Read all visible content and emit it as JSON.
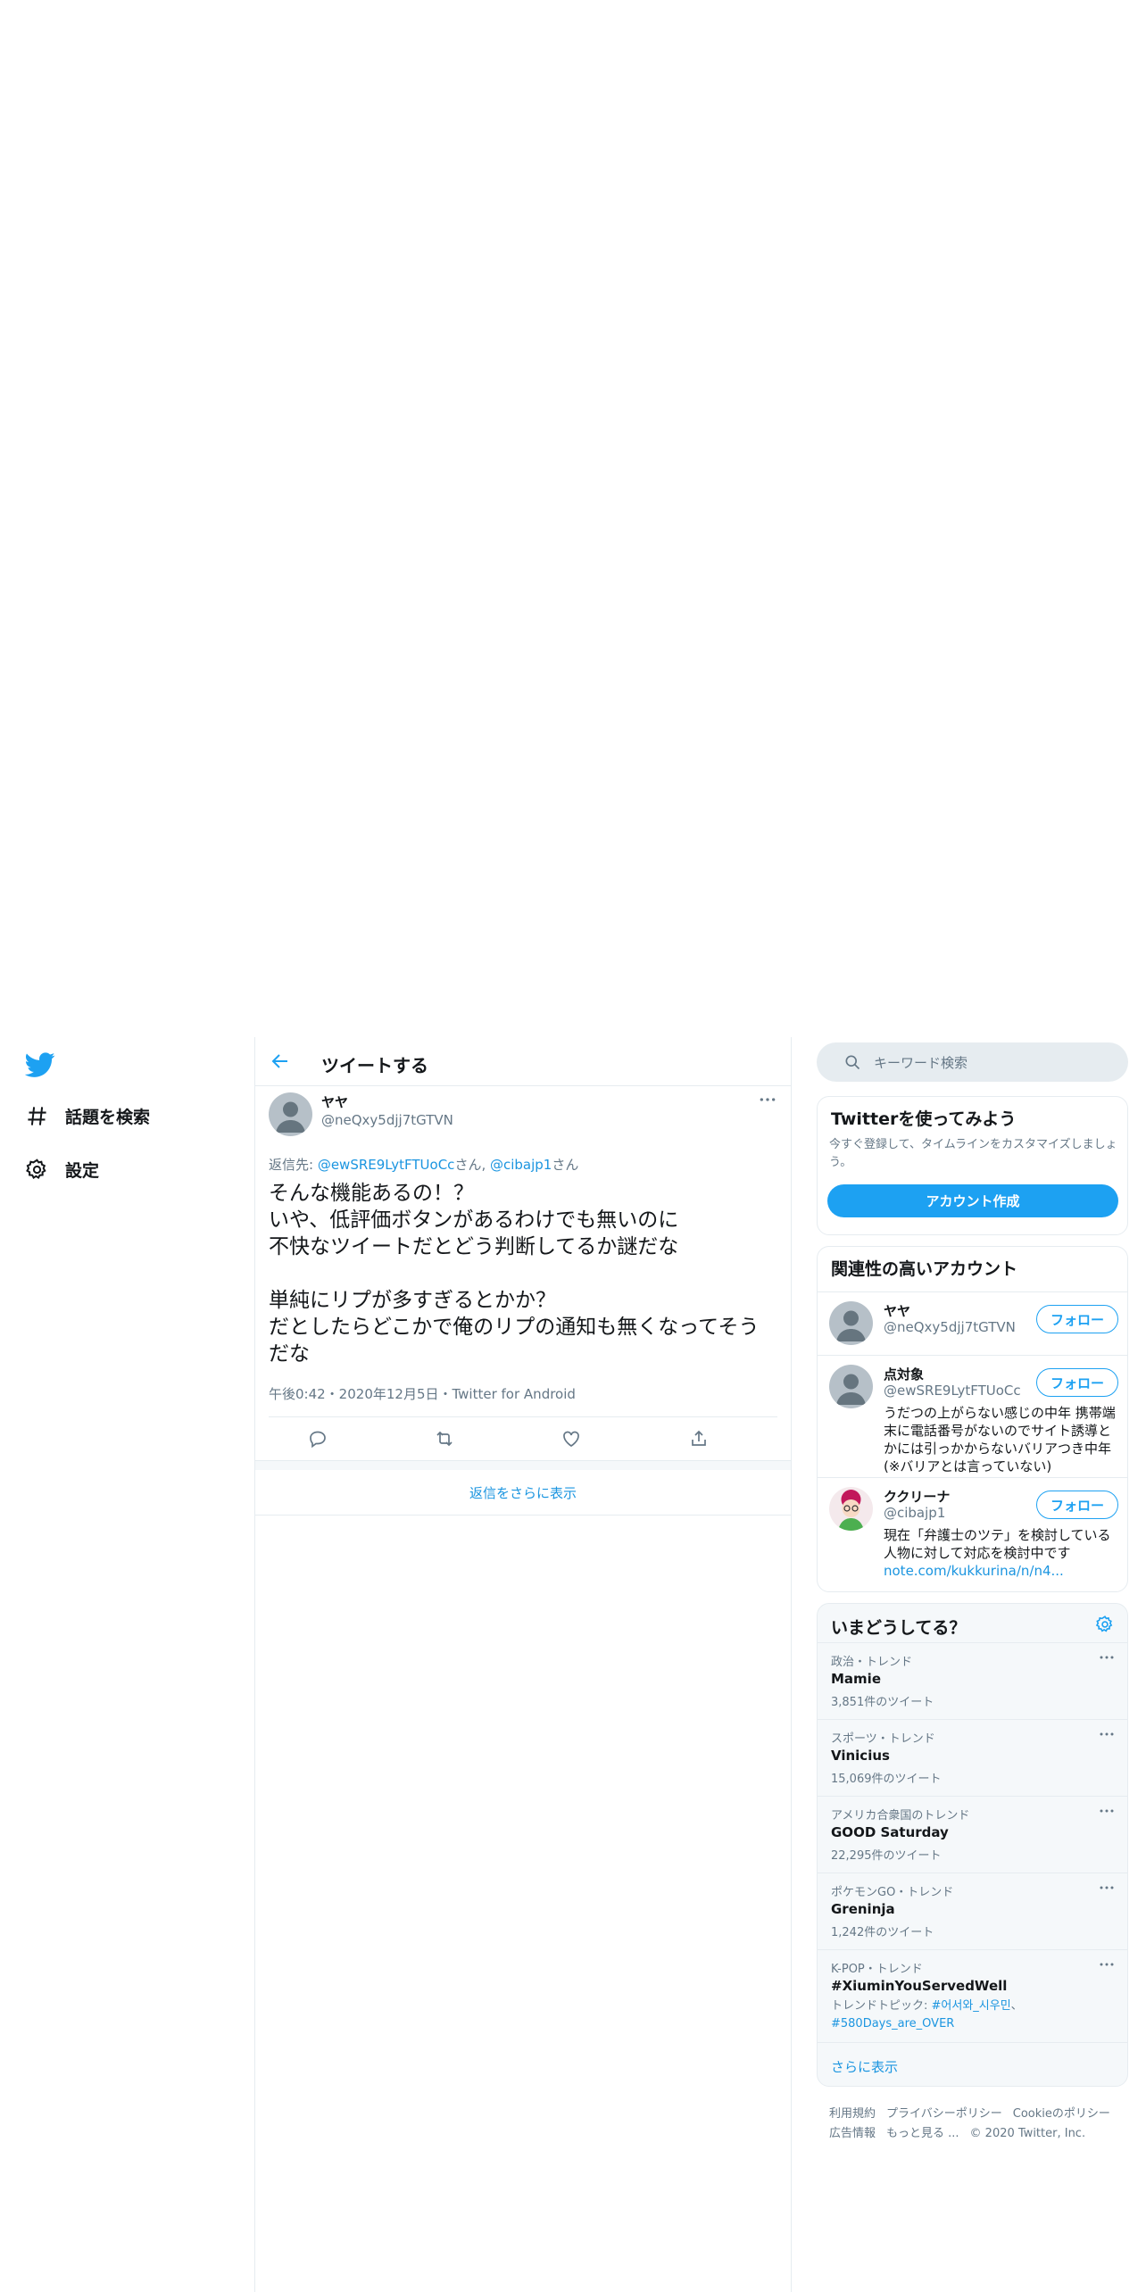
{
  "nav": {
    "items": [
      {
        "label": "話題を検索",
        "icon": "hashtag-icon"
      },
      {
        "label": "設定",
        "icon": "gear-icon"
      }
    ]
  },
  "center": {
    "header_title": "ツイートする",
    "tweet": {
      "name": "ヤヤ",
      "handle": "@neQxy5djj7tGTVN",
      "reply_prefix": "返信先: ",
      "reply_user1": "@ewSRE9LytFTUoCc",
      "reply_sep1": "さん, ",
      "reply_user2": "@cibajp1",
      "reply_sep2": "さん",
      "body": "そんな機能あるの！？\nいや、低評価ボタンがあるわけでも無いのに\n不快なツイートだとどう判断してるか謎だな\n\n単純にリプが多すぎるとかか？\nだとしたらどこかで俺のリプの通知も無くなってそうだな",
      "meta": "午後0:42・2020年12月5日・Twitter for Android"
    },
    "show_more_replies": "返信をさらに表示"
  },
  "right": {
    "search_placeholder": "キーワード検索",
    "signup": {
      "title": "Twitterを使ってみよう",
      "desc": "今すぐ登録して、タイムラインをカスタマイズしましょう。",
      "button": "アカウント作成"
    },
    "related": {
      "title": "関連性の高いアカウント",
      "follow_label": "フォロー",
      "accounts": [
        {
          "name": "ヤヤ",
          "handle": "@neQxy5djj7tGTVN",
          "bio": ""
        },
        {
          "name": "点対象",
          "handle": "@ewSRE9LytFTUoCc",
          "bio": "うだつの上がらない感じの中年 携帯端末に電話番号がないのでサイト誘導とかには引っかからないバリアつき中年(※バリアとは言っていない)"
        },
        {
          "name": "ククリーナ",
          "handle": "@cibajp1",
          "bio": "現在「弁護士のツテ」を検討している人物に対して対応を検討中です",
          "link": "note.com/kukkurina/n/n4..."
        }
      ]
    },
    "trends": {
      "title": "いまどうしてる？",
      "items": [
        {
          "context": "政治・トレンド",
          "title": "Mamie",
          "count": "3,851件のツイート"
        },
        {
          "context": "スポーツ・トレンド",
          "title": "Vinicius",
          "count": "15,069件のツイート"
        },
        {
          "context": "アメリカ合衆国のトレンド",
          "title": "GOOD Saturday",
          "count": "22,295件のツイート"
        },
        {
          "context": "ポケモンGO・トレンド",
          "title": "Greninja",
          "count": "1,242件のツイート"
        },
        {
          "context": "K-POP・トレンド",
          "title": "#XiuminYouServedWell",
          "topics_prefix": "トレンドトピック: ",
          "topic1": "#어서와_시우민",
          "topic_sep": "、",
          "topic2": "#580Days_are_OVER"
        }
      ],
      "show_more": "さらに表示"
    },
    "footer": {
      "links": [
        "利用規約",
        "プライバシーポリシー",
        "Cookieのポリシー",
        "広告情報",
        "もっと見る ..."
      ],
      "copyright": "© 2020 Twitter, Inc."
    }
  },
  "colors": {
    "accent": "#1da1f2",
    "link": "#1b95e0",
    "muted": "#657786",
    "border": "#e6ecf0"
  }
}
